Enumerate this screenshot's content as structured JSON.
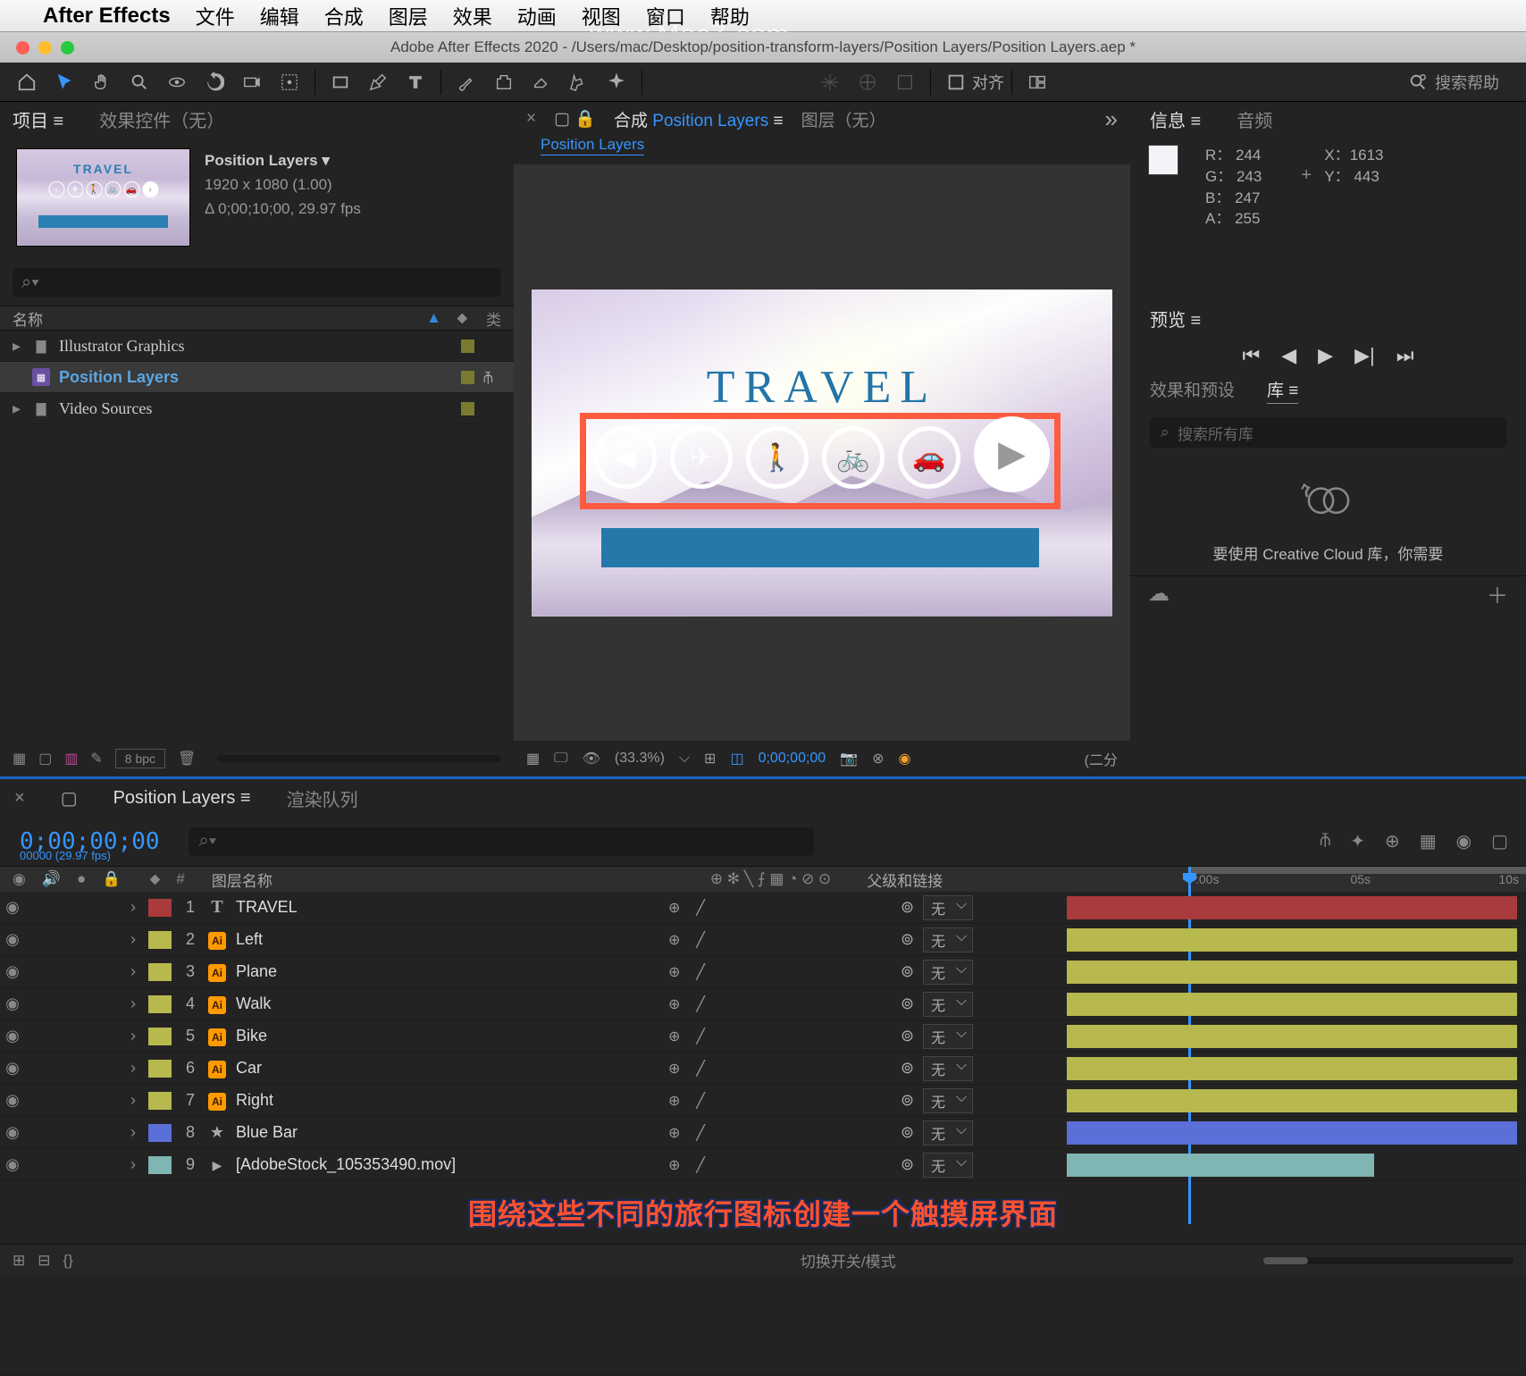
{
  "menubar": {
    "app": "After Effects",
    "items": [
      "文件",
      "编辑",
      "合成",
      "图层",
      "效果",
      "动画",
      "视图",
      "窗口",
      "帮助"
    ]
  },
  "title": "Adobe After Effects 2020 - /Users/mac/Desktop/position-transform-layers/Position Layers/Position Layers.aep *",
  "watermark": "www.MacZ.com",
  "toolbar": {
    "align": "对齐",
    "search": "搜索帮助"
  },
  "project": {
    "tab_project": "项目",
    "tab_effect": "效果控件（无）",
    "comp_name": "Position Layers ▾",
    "comp_dim": "1920 x 1080 (1.00)",
    "comp_dur": "Δ 0;00;10;00, 29.97 fps",
    "name_col": "名称",
    "items": [
      {
        "icon": "folder",
        "name": "Illustrator Graphics",
        "chev": "▸"
      },
      {
        "icon": "comp",
        "name": "Position Layers",
        "chev": "",
        "sel": true
      },
      {
        "icon": "folder",
        "name": "Video Sources",
        "chev": "▸"
      }
    ],
    "bpc": "8 bpc"
  },
  "comp": {
    "tab_comp": "合成",
    "tab_name": "Position Layers",
    "tab_layer": "图层（无）",
    "subtab": "Position Layers",
    "travel": "TRAVEL",
    "pct": "(33.3%)",
    "time": "0;00;00;00",
    "end": "(二分"
  },
  "info": {
    "tab_info": "信息",
    "tab_audio": "音频",
    "r": "R：",
    "rv": "244",
    "g": "G：",
    "gv": "243",
    "b": "B：",
    "bv": "247",
    "a": "A：",
    "av": "255",
    "x": "X：",
    "xv": "1613",
    "y": "Y：",
    "yv": "443"
  },
  "preview": {
    "tab": "预览"
  },
  "lib": {
    "tab_fx": "效果和预设",
    "tab_lib": "库",
    "search_ph": "搜索所有库",
    "msg": "要使用 Creative Cloud 库，你需要"
  },
  "timeline": {
    "tab_comp": "Position Layers",
    "tab_render": "渲染队列",
    "timecode": "0;00;00;00",
    "frames": "00000 (29.97 fps)",
    "ruler_ticks": [
      ":00s",
      "05s",
      "10s"
    ],
    "col_layer": "图层名称",
    "col_parent": "父级和链接",
    "footer_mid": "切换开关/模式",
    "layers": [
      {
        "n": 1,
        "ico": "T",
        "name": "TRAVEL",
        "lab": "lb-red",
        "bar": "bar-red",
        "par": "无"
      },
      {
        "n": 2,
        "ico": "Ai",
        "name": "Left",
        "lab": "lb-yel",
        "bar": "bar-yel",
        "par": "无"
      },
      {
        "n": 3,
        "ico": "Ai",
        "name": "Plane",
        "lab": "lb-yel",
        "bar": "bar-yel",
        "par": "无"
      },
      {
        "n": 4,
        "ico": "Ai",
        "name": "Walk",
        "lab": "lb-yel",
        "bar": "bar-yel",
        "par": "无"
      },
      {
        "n": 5,
        "ico": "Ai",
        "name": "Bike",
        "lab": "lb-yel",
        "bar": "bar-yel",
        "par": "无"
      },
      {
        "n": 6,
        "ico": "Ai",
        "name": "Car",
        "lab": "lb-yel",
        "bar": "bar-yel",
        "par": "无"
      },
      {
        "n": 7,
        "ico": "Ai",
        "name": "Right",
        "lab": "lb-yel",
        "bar": "bar-yel",
        "par": "无"
      },
      {
        "n": 8,
        "ico": "star",
        "name": "Blue Bar",
        "lab": "lb-blue",
        "bar": "bar-blue",
        "par": "无"
      },
      {
        "n": 9,
        "ico": "vid",
        "name": "[AdobeStock_105353490.mov]",
        "lab": "lb-teal",
        "bar": "bar-teal",
        "par": "无"
      }
    ]
  },
  "caption": "围绕这些不同的旅行图标创建一个触摸屏界面"
}
